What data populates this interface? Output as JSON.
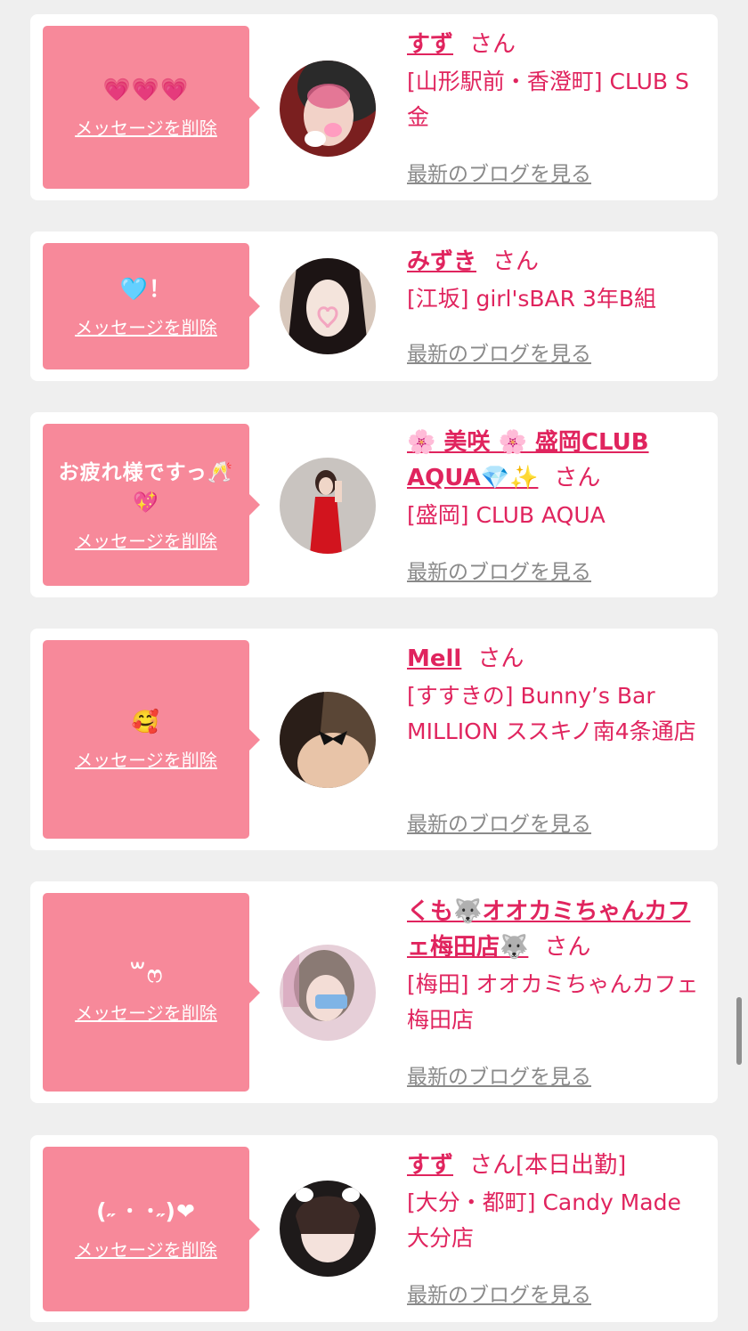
{
  "delete_label": "メッセージを削除",
  "san_label": "さん",
  "blog_label": "最新のブログを見る",
  "colors": {
    "bubble": "#f7899a",
    "name": "#e0245e",
    "blog_link": "#8a8a8a",
    "background": "#efefef"
  },
  "items": [
    {
      "message": "💗💗💗",
      "name": "すず",
      "name_extra": "",
      "shop": "[山形駅前・香澄町] CLUB S金",
      "avatar_icon": "avatar-photo-icon"
    },
    {
      "message": "🩵！",
      "name": "みずき",
      "name_extra": "",
      "shop": "[江坂] girl'sBAR 3年B組",
      "avatar_icon": "avatar-photo-icon"
    },
    {
      "message": "お疲れ様ですっ🥂💖",
      "name": "🌸 美咲 🌸 盛岡CLUB AQUA💎✨",
      "name_extra": "",
      "shop": "[盛岡] CLUB AQUA",
      "avatar_icon": "avatar-photo-icon"
    },
    {
      "message": "🥰",
      "name": "Mell",
      "name_extra": "",
      "shop": "[すすきの] Bunny’s Bar MILLION ススキノ南4条通店",
      "avatar_icon": "avatar-photo-icon"
    },
    {
      "message": "꒳ෆ",
      "name": "くも🐺オオカミちゃんカフェ梅田店🐺",
      "name_extra": "",
      "shop": "[梅田] オオカミちゃんカフェ梅田店",
      "avatar_icon": "avatar-photo-icon"
    },
    {
      "message": "(˶ ･ ･˶)❤",
      "name": "すず",
      "name_extra": "[本日出勤]",
      "shop": "[大分・都町] Candy Made 大分店",
      "avatar_icon": "avatar-photo-icon"
    }
  ]
}
